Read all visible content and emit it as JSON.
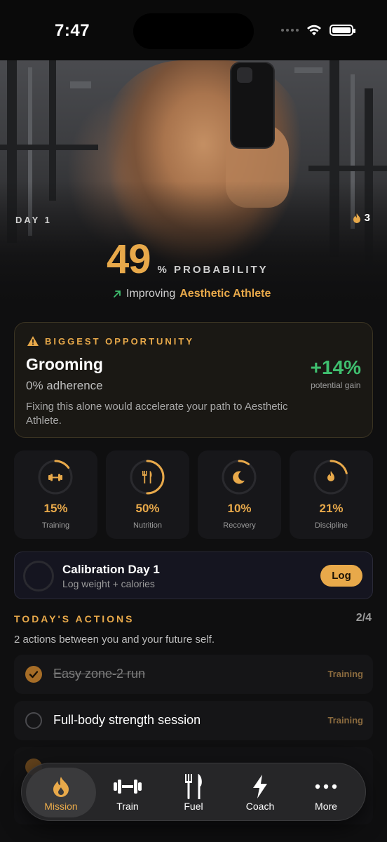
{
  "status_bar": {
    "time": "7:47"
  },
  "hero": {
    "day_label": "DAY 1",
    "streak_count": "3",
    "probability_value": "49",
    "probability_label": "% PROBABILITY",
    "improving_text": "Improving",
    "target_archetype": "Aesthetic Athlete"
  },
  "opportunity": {
    "title": "BIGGEST OPPORTUNITY",
    "name": "Grooming",
    "adherence": "0% adherence",
    "description": "Fixing this alone would accelerate your path to Aesthetic Athlete.",
    "gain_value": "+14%",
    "gain_label": "potential gain"
  },
  "metrics": [
    {
      "value": "15%",
      "label": "Training",
      "fraction": 0.15,
      "icon": "dumbbell-icon"
    },
    {
      "value": "50%",
      "label": "Nutrition",
      "fraction": 0.5,
      "icon": "fork-knife-icon"
    },
    {
      "value": "10%",
      "label": "Recovery",
      "fraction": 0.1,
      "icon": "moon-icon"
    },
    {
      "value": "21%",
      "label": "Discipline",
      "fraction": 0.21,
      "icon": "flame-icon"
    }
  ],
  "calibration": {
    "title": "Calibration Day 1",
    "subtitle": "Log weight + calories",
    "button_label": "Log"
  },
  "actions": {
    "title": "TODAY'S ACTIONS",
    "count": "2/4",
    "subtitle": "2 actions between you and your future self.",
    "items": [
      {
        "label": "Easy zone-2 run",
        "tag": "Training",
        "done": true
      },
      {
        "label": "Full-body strength session",
        "tag": "Training",
        "done": false
      }
    ]
  },
  "tabbar": {
    "tabs": [
      {
        "label": "Mission",
        "icon": "flame-icon",
        "active": true
      },
      {
        "label": "Train",
        "icon": "dumbbell-icon",
        "active": false
      },
      {
        "label": "Fuel",
        "icon": "fork-knife-icon",
        "active": false
      },
      {
        "label": "Coach",
        "icon": "bolt-icon",
        "active": false
      },
      {
        "label": "More",
        "icon": "more-dots-icon",
        "active": false
      }
    ]
  },
  "colors": {
    "accent": "#e8a94a",
    "gain": "#3fbf6f",
    "background": "#0f0f10"
  }
}
